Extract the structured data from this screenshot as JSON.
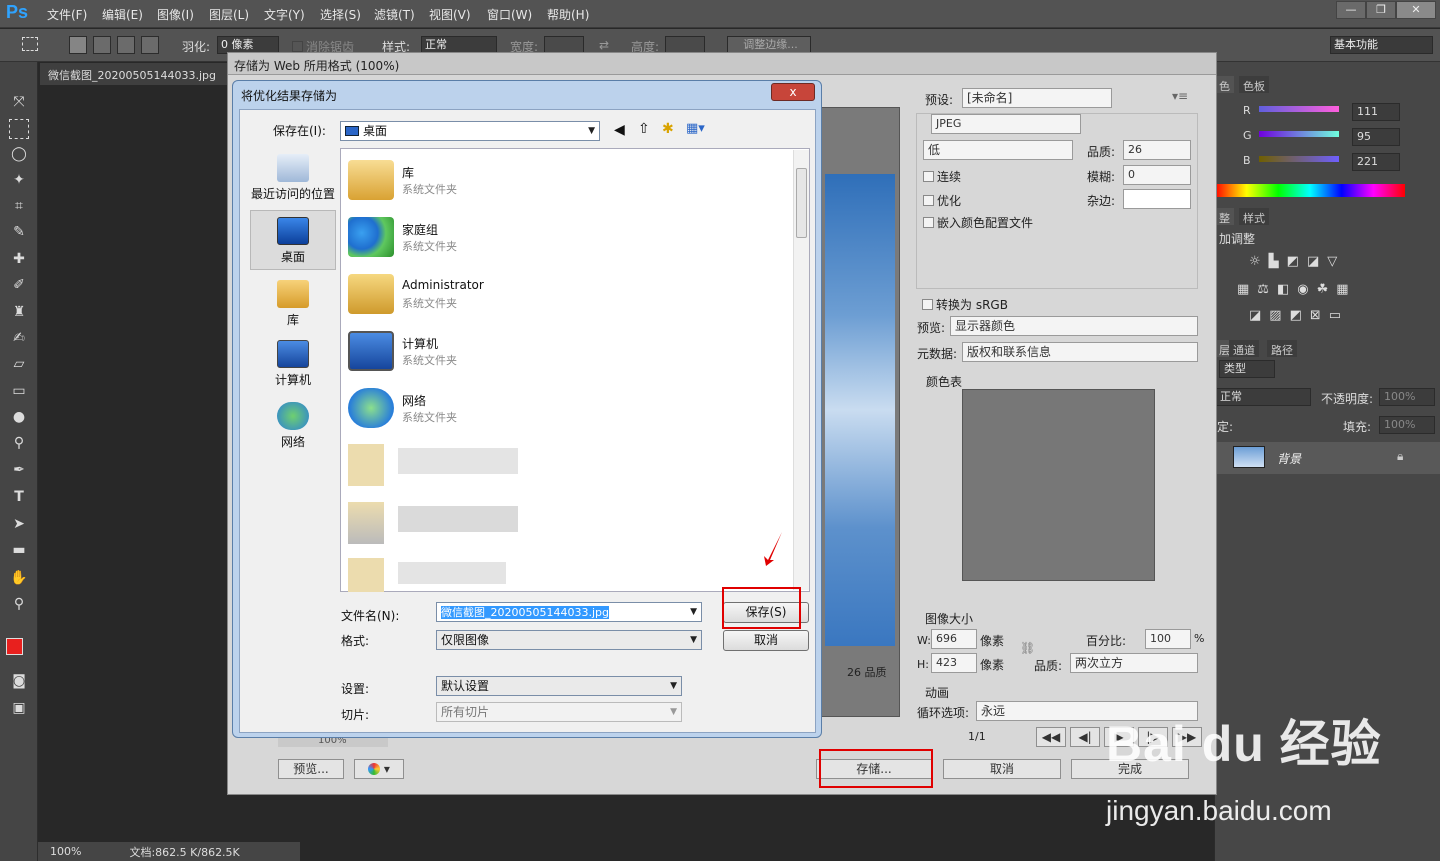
{
  "app": {
    "logo": "Ps",
    "menu": [
      "文件(F)",
      "编辑(E)",
      "图像(I)",
      "图层(L)",
      "文字(Y)",
      "选择(S)",
      "滤镜(T)",
      "视图(V)",
      "窗口(W)",
      "帮助(H)"
    ],
    "window_buttons": [
      "—",
      "❐",
      "✕"
    ]
  },
  "options_bar": {
    "feather_label": "羽化:",
    "feather_value": "0 像素",
    "antialias_label": "消除锯齿",
    "style_label": "样式:",
    "style_value": "正常",
    "width_label": "宽度:",
    "height_label": "高度:",
    "refine_edge": "调整边缘...",
    "workspace": "基本功能"
  },
  "document": {
    "tab_name": "微信截图_20200505144033.jpg",
    "zoom": "100%",
    "doc_info": "文档:862.5 K/862.5K"
  },
  "right_panel": {
    "color_tabs": [
      "色",
      "色板"
    ],
    "rgb_labels": [
      "R",
      "G",
      "B"
    ],
    "rgb_values": [
      "111",
      "95",
      "221"
    ],
    "adjust_tabs": [
      "整",
      "样式"
    ],
    "adjust_title": "加调整",
    "layers_tabs": [
      "层",
      "通道",
      "路径"
    ],
    "kind_label": "类型",
    "blend_mode": "正常",
    "opacity_label": "不透明度:",
    "opacity_value": "100%",
    "lock_label": "定:",
    "fill_label": "填充:",
    "fill_value": "100%",
    "layer_name": "背景"
  },
  "save_for_web": {
    "title": "存储为 Web 所用格式 (100%)",
    "preset_label": "预设:",
    "preset_value": "[未命名]",
    "format_value": "JPEG",
    "compression_value": "低",
    "quality_label": "品质:",
    "quality_value": "26",
    "progressive_label": "连续",
    "blur_label": "模糊:",
    "blur_value": "0",
    "optimized_label": "优化",
    "matte_label": "杂边:",
    "embed_profile_label": "嵌入颜色配置文件",
    "convert_srgb_label": "转换为 sRGB",
    "preview_label": "预览:",
    "preview_value": "显示器颜色",
    "metadata_label": "元数据:",
    "metadata_value": "版权和联系信息",
    "color_table_label": "颜色表",
    "image_size_label": "图像大小",
    "w_label": "W:",
    "w_value": "696",
    "h_label": "H:",
    "h_value": "423",
    "px_unit": "像素",
    "percent_label": "百分比:",
    "percent_value": "100",
    "percent_unit": "%",
    "resample_label": "品质:",
    "resample_value": "两次立方",
    "animation_label": "动画",
    "loop_label": "循环选项:",
    "loop_value": "永远",
    "frame_counter": "1/1",
    "quality_info": "26 品质",
    "zoom_value": "100%",
    "preview_button": "预览...",
    "save_button": "存储...",
    "cancel_button": "取消",
    "done_button": "完成"
  },
  "file_dialog": {
    "title": "将优化结果存储为",
    "close": "x",
    "save_in_label": "保存在(I):",
    "save_in_value": "桌面",
    "places": [
      "最近访问的位置",
      "桌面",
      "库",
      "计算机",
      "网络"
    ],
    "items": [
      {
        "name": "库",
        "sub": "系统文件夹"
      },
      {
        "name": "家庭组",
        "sub": "系统文件夹"
      },
      {
        "name": "Administrator",
        "sub": "系统文件夹"
      },
      {
        "name": "计算机",
        "sub": "系统文件夹"
      },
      {
        "name": "网络",
        "sub": "系统文件夹"
      }
    ],
    "filename_label": "文件名(N):",
    "filename_value": "微信截图_20200505144033.jpg",
    "format_label": "格式:",
    "format_value": "仅限图像",
    "settings_label": "设置:",
    "settings_value": "默认设置",
    "slices_label": "切片:",
    "slices_value": "所有切片",
    "save_button": "保存(S)",
    "cancel_button": "取消"
  },
  "watermark": {
    "brand": "Bai du 经验",
    "url": "jingyan.baidu.com"
  },
  "colors": {
    "accent_red": "#e00000",
    "ps_blue": "#2fa3ff",
    "fg_color": "#e8201e",
    "bg_color": "#6f5fdd"
  }
}
